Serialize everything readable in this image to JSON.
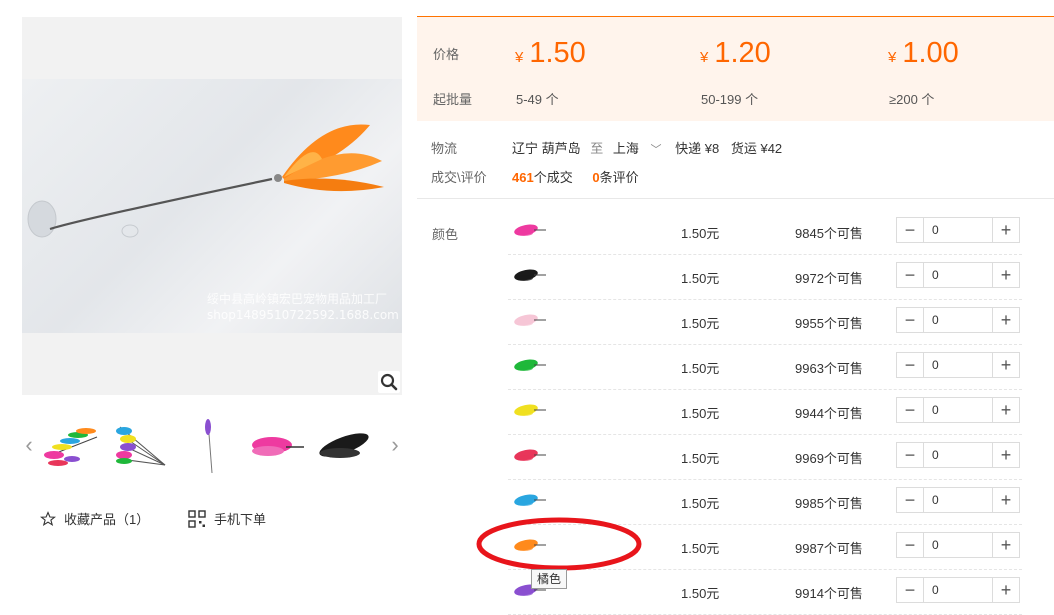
{
  "gallery": {
    "watermark_line1": "绥中县高岭镇宏巴宠物用品加工厂",
    "watermark_line2": "shop1489510722592.1688.com",
    "zoom_icon": "magnifier-icon",
    "thumbnails": [
      "multicolor-feather-bundle",
      "multicolor-feather-sticks",
      "purple-feather-rod",
      "pink-feather",
      "black-feather"
    ]
  },
  "actions": {
    "favorite_label": "收藏产品（1）",
    "mobile_order_label": "手机下单"
  },
  "price": {
    "price_label": "价格",
    "moq_label": "起批量",
    "currency": "¥",
    "tiers": [
      {
        "price": "1.50",
        "qty": "5-49 个"
      },
      {
        "price": "1.20",
        "qty": "50-199 个"
      },
      {
        "price": "1.00",
        "qty": "≥200 个"
      }
    ]
  },
  "logistics": {
    "label": "物流",
    "from": "辽宁 葫芦岛",
    "to_word": "至",
    "to": "上海",
    "express": "快递 ¥8",
    "freight": "货运 ¥42"
  },
  "deals": {
    "label": "成交\\评价",
    "count": "461",
    "count_suffix": "个成交",
    "reviews": "0",
    "reviews_suffix": "条评价"
  },
  "sku": {
    "color_label": "颜色",
    "rows": [
      {
        "color": "#ee3aa0",
        "price": "1.50元",
        "stock": "9845个可售",
        "qty": "0"
      },
      {
        "color": "#1a1a1a",
        "price": "1.50元",
        "stock": "9972个可售",
        "qty": "0"
      },
      {
        "color": "#f6c6d6",
        "price": "1.50元",
        "stock": "9955个可售",
        "qty": "0"
      },
      {
        "color": "#1fb83a",
        "price": "1.50元",
        "stock": "9963个可售",
        "qty": "0"
      },
      {
        "color": "#f0e020",
        "price": "1.50元",
        "stock": "9944个可售",
        "qty": "0"
      },
      {
        "color": "#e8365a",
        "price": "1.50元",
        "stock": "9969个可售",
        "qty": "0"
      },
      {
        "color": "#2aa6e0",
        "price": "1.50元",
        "stock": "9985个可售",
        "qty": "0"
      },
      {
        "color": "#ff8a1c",
        "price": "1.50元",
        "stock": "9987个可售",
        "qty": "0"
      },
      {
        "color": "#8a4fd0",
        "price": "1.50元",
        "stock": "9914个可售",
        "qty": "0"
      }
    ],
    "tooltip": "橘色"
  },
  "colors": {
    "accent": "#ff6600",
    "price_bg": "#fff4ec",
    "annotation": "#e8151b"
  }
}
